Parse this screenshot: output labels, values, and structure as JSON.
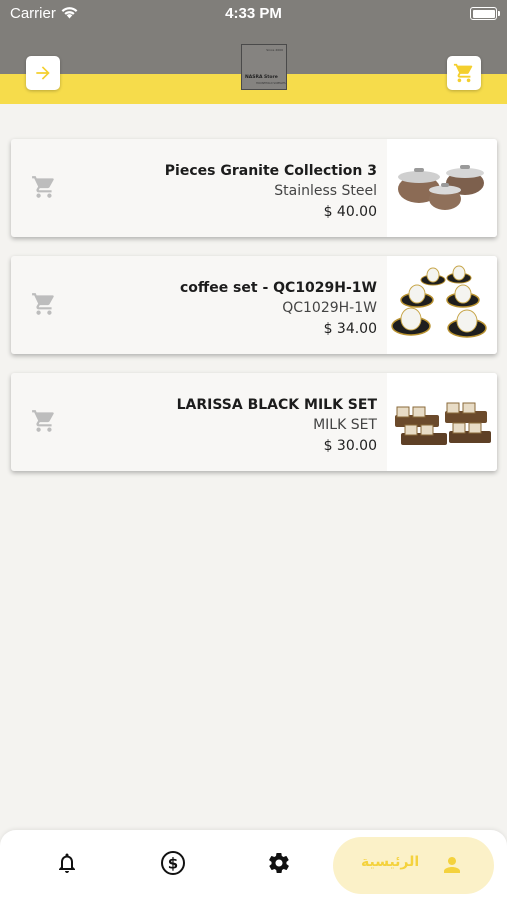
{
  "status_bar": {
    "carrier": "Carrier",
    "time": "4:33 PM"
  },
  "header": {
    "back_icon": "arrow-right-icon",
    "cart_icon": "cart-icon",
    "logo": {
      "name": "NASRA Store",
      "tagline": "Since 2000",
      "subtitle": "HOUSEHOLD SUPPLIES"
    }
  },
  "colors": {
    "accent_yellow": "#f6dc4b",
    "header_gray": "#807e7a",
    "cart_gray": "#bdbdbd",
    "home_pill": "#fbf1c8",
    "home_label": "#f4d23e"
  },
  "products": [
    {
      "title": "Pieces Granite Collection 3",
      "subtitle": "Stainless Steel",
      "price": "$ 40.00",
      "image": "granite-pots-image",
      "cart_icon": "add-to-cart-icon"
    },
    {
      "title": "coffee set - QC1029H-1W",
      "subtitle": "QC1029H-1W",
      "price": "$ 34.00",
      "image": "coffee-set-image",
      "cart_icon": "add-to-cart-icon"
    },
    {
      "title": "LARISSA BLACK MILK SET",
      "subtitle": "MILK SET",
      "price": "$ 30.00",
      "image": "milk-set-image",
      "cart_icon": "add-to-cart-icon"
    }
  ],
  "tabbar": {
    "items": [
      {
        "icon": "bell-icon"
      },
      {
        "icon": "dollar-icon"
      },
      {
        "icon": "gear-icon"
      },
      {
        "icon": "person-icon",
        "label": "الرئيسية"
      }
    ]
  }
}
